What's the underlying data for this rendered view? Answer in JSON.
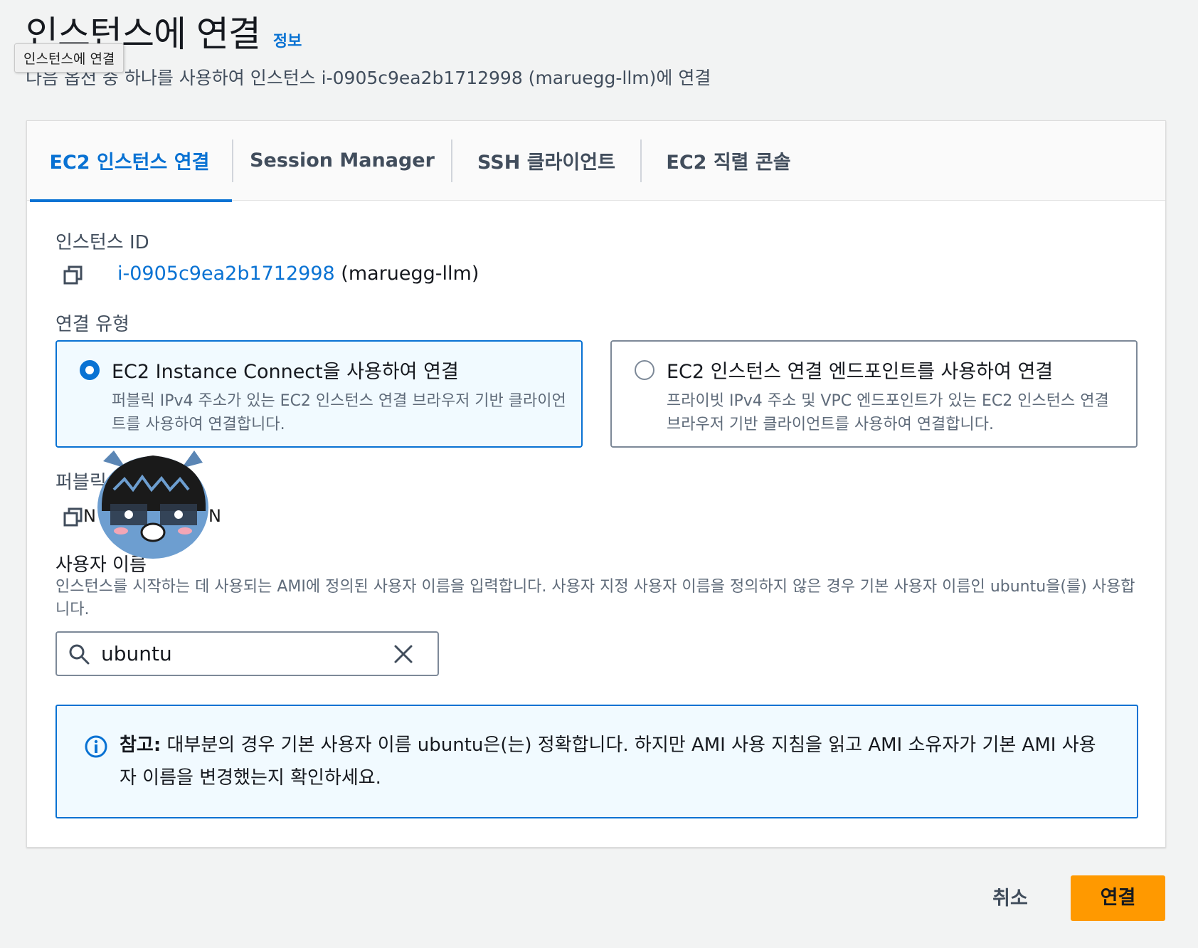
{
  "header": {
    "title": "인스턴스에 연결",
    "info_link": "정보",
    "tooltip": "인스턴스에 연결",
    "subtitle": "다음 옵션 중 하나를 사용하여 인스턴스 i-0905c9ea2b1712998 (maruegg-llm)에 연결"
  },
  "tabs": [
    {
      "label": "EC2 인스턴스 연결",
      "active": true
    },
    {
      "label": "Session Manager",
      "active": false
    },
    {
      "label": "SSH 클라이언트",
      "active": false
    },
    {
      "label": "EC2 직렬 콘솔",
      "active": false
    }
  ],
  "instance": {
    "label": "인스턴스 ID",
    "id": "i-0905c9ea2b1712998",
    "name": "(maruegg-llm)"
  },
  "connection_type": {
    "label": "연결 유형",
    "options": [
      {
        "title": "EC2 Instance Connect을 사용하여 연결",
        "desc": "퍼블릭 IPv4 주소가 있는 EC2 인스턴스 연결 브라우저 기반 클라이언트를 사용하여 연결합니다.",
        "selected": true
      },
      {
        "title": "EC2 인스턴스 연결 엔드포인트를 사용하여 연결",
        "desc": "프라이빗 IPv4 주소 및 VPC 엔드포인트가 있는 EC2 인스턴스 연결 브라우저 기반 클라이언트를 사용하여 연결합니다.",
        "selected": false
      }
    ]
  },
  "public_ip": {
    "label": "퍼블릭"
  },
  "username": {
    "label": "사용자 이름",
    "desc": "인스턴스를 시작하는 데 사용되는 AMI에 정의된 사용자 이름을 입력합니다. 사용자 지정 사용자 이름을 정의하지 않은 경우 기본 사용자 이름인 ubuntu을(를) 사용합니다.",
    "value": "ubuntu"
  },
  "alert": {
    "bold": "참고:",
    "text": " 대부분의 경우 기본 사용자 이름 ubuntu은(는) 정확합니다. 하지만 AMI 사용 지침을 읽고 AMI 소유자가 기본 AMI 사용자 이름을 변경했는지 확인하세요."
  },
  "footer": {
    "cancel": "취소",
    "connect": "연결"
  },
  "colors": {
    "accent": "#0972d3",
    "primary_button": "#ff9900"
  }
}
